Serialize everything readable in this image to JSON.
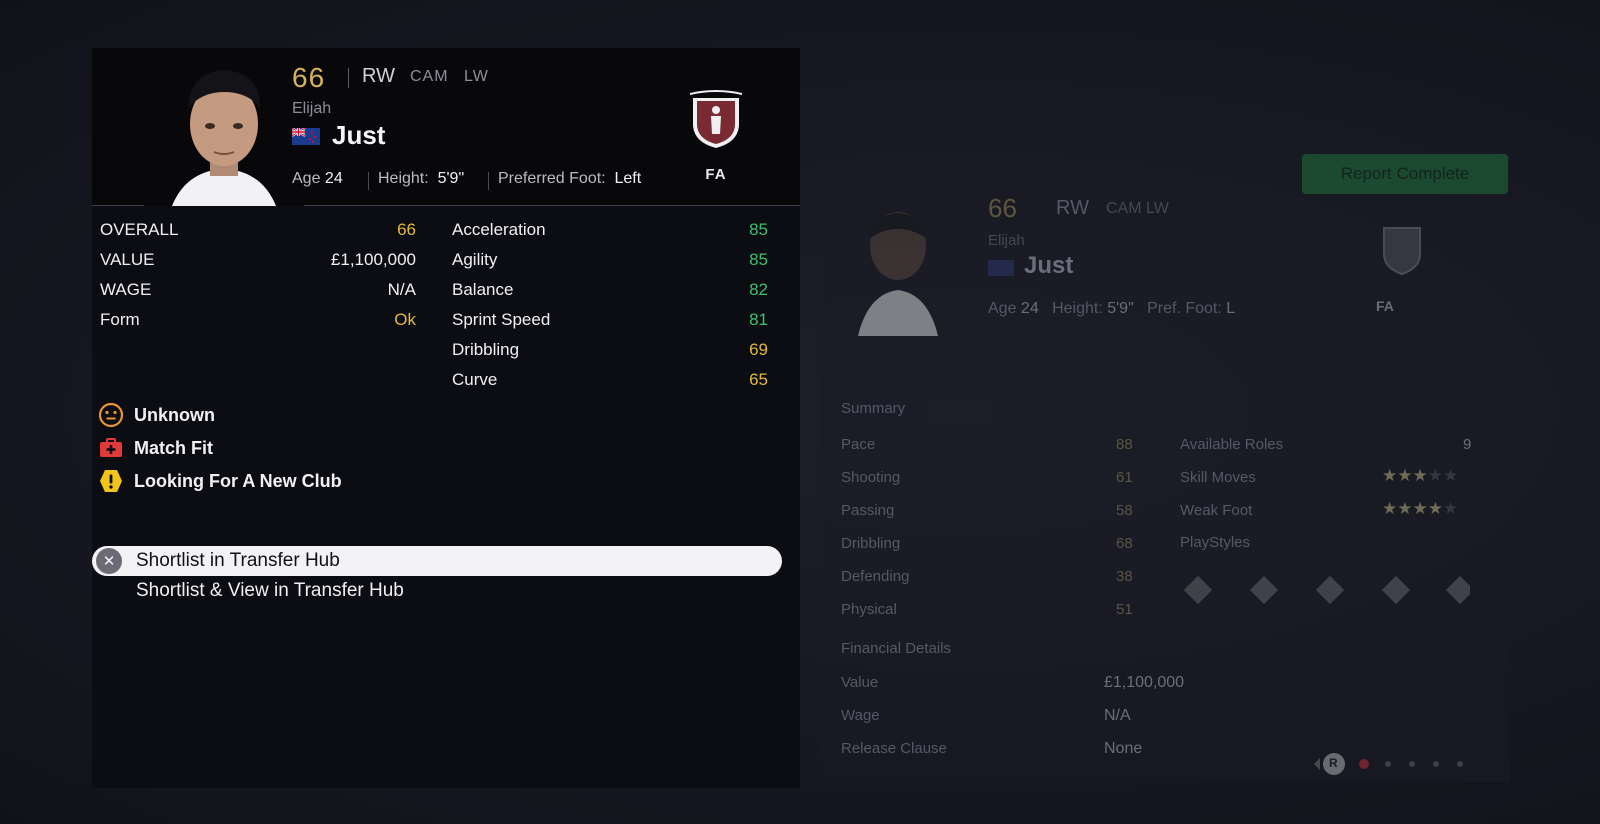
{
  "player": {
    "overall": "66",
    "positions": {
      "main": "RW",
      "alt1": "CAM",
      "alt2": "LW"
    },
    "first_name": "Elijah",
    "last_name": "Just",
    "age_label": "Age",
    "age": "24",
    "height_label": "Height:",
    "height": "5'9\"",
    "foot_label": "Preferred Foot:",
    "foot": "Left",
    "club": "FA"
  },
  "left_stats": [
    {
      "label": "OVERALL",
      "value": "66",
      "color": "#e2b93b"
    },
    {
      "label": "VALUE",
      "value": "£1,100,000",
      "color": "#f0f0f2"
    },
    {
      "label": "WAGE",
      "value": "N/A",
      "color": "#f0f0f2"
    },
    {
      "label": "Form",
      "value": "Ok",
      "color": "#e2b93b"
    }
  ],
  "attributes": [
    {
      "label": "Acceleration",
      "value": "85",
      "color": "#3fbf72"
    },
    {
      "label": "Agility",
      "value": "85",
      "color": "#3fbf72"
    },
    {
      "label": "Balance",
      "value": "82",
      "color": "#3fbf72"
    },
    {
      "label": "Sprint Speed",
      "value": "81",
      "color": "#3fbf72"
    },
    {
      "label": "Dribbling",
      "value": "69",
      "color": "#e2b93b"
    },
    {
      "label": "Curve",
      "value": "65",
      "color": "#e2b93b"
    }
  ],
  "statuses": [
    {
      "icon": "face-neutral-icon",
      "label": "Unknown"
    },
    {
      "icon": "medical-kit-icon",
      "label": "Match Fit"
    },
    {
      "icon": "warning-icon",
      "label": "Looking For A New Club"
    }
  ],
  "menu": [
    {
      "label": "Shortlist in Transfer Hub",
      "selected": true,
      "icon": "x-button-icon"
    },
    {
      "label": "Shortlist & View in Transfer Hub",
      "selected": false
    }
  ],
  "report": {
    "button": "Report Complete",
    "overall": "66",
    "pos_main": "RW",
    "pos_alt": "CAM LW",
    "first_name": "Elijah",
    "last_name": "Just",
    "age_label": "Age",
    "age": "24",
    "height_label": "Height:",
    "height": "5'9\"",
    "foot_label": "Pref. Foot:",
    "foot": "L",
    "club": "FA",
    "summary_title": "Summary",
    "summary": [
      {
        "label": "Pace",
        "value": "88"
      },
      {
        "label": "Shooting",
        "value": "61"
      },
      {
        "label": "Passing",
        "value": "58"
      },
      {
        "label": "Dribbling",
        "value": "68"
      },
      {
        "label": "Defending",
        "value": "38"
      },
      {
        "label": "Physical",
        "value": "51"
      }
    ],
    "roles_label": "Available Roles",
    "roles_value": "9",
    "skill_label": "Skill Moves",
    "skill_stars": 3,
    "weak_label": "Weak Foot",
    "weak_stars": 4,
    "playstyles_label": "PlayStyles",
    "financial_title": "Financial Details",
    "financial": [
      {
        "label": "Value",
        "value": "£1,100,000"
      },
      {
        "label": "Wage",
        "value": "N/A"
      },
      {
        "label": "Release Clause",
        "value": "None"
      }
    ],
    "pager_button": "R"
  }
}
